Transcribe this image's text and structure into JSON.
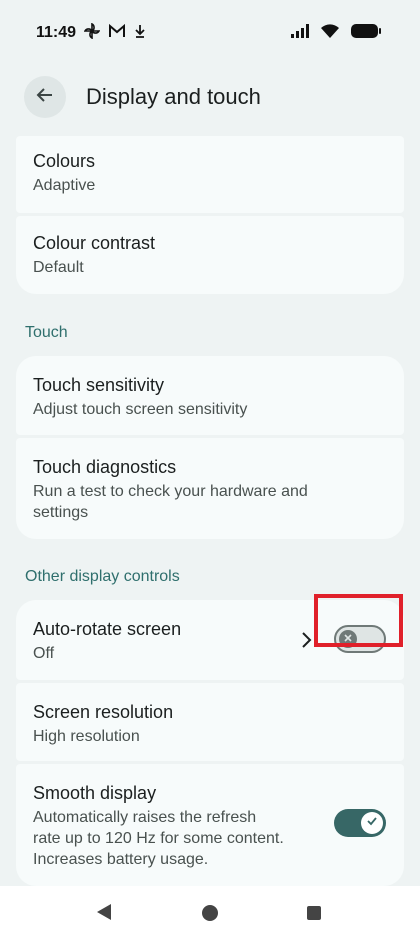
{
  "status": {
    "time": "11:49"
  },
  "header": {
    "title": "Display and touch"
  },
  "display_items": [
    {
      "title": "Colours",
      "subtitle": "Adaptive"
    },
    {
      "title": "Colour contrast",
      "subtitle": "Default"
    }
  ],
  "sections": {
    "touch": "Touch",
    "other": "Other display controls"
  },
  "touch_items": [
    {
      "title": "Touch sensitivity",
      "subtitle": "Adjust touch screen sensitivity"
    },
    {
      "title": "Touch diagnostics",
      "subtitle_line1": "Run a test to check your hardware and",
      "subtitle_line2": "settings"
    }
  ],
  "other_items": [
    {
      "title": "Auto-rotate screen",
      "subtitle": "Off",
      "toggle": "off"
    },
    {
      "title": "Screen resolution",
      "subtitle": "High resolution"
    },
    {
      "title": "Smooth display",
      "subtitle_line1": "Automatically raises the refresh",
      "subtitle_line2": "rate up to 120 Hz for some content.",
      "subtitle_line3": "Increases battery usage.",
      "toggle": "on"
    }
  ],
  "colors": {
    "accent": "#376766",
    "highlight": "#e0202a"
  }
}
